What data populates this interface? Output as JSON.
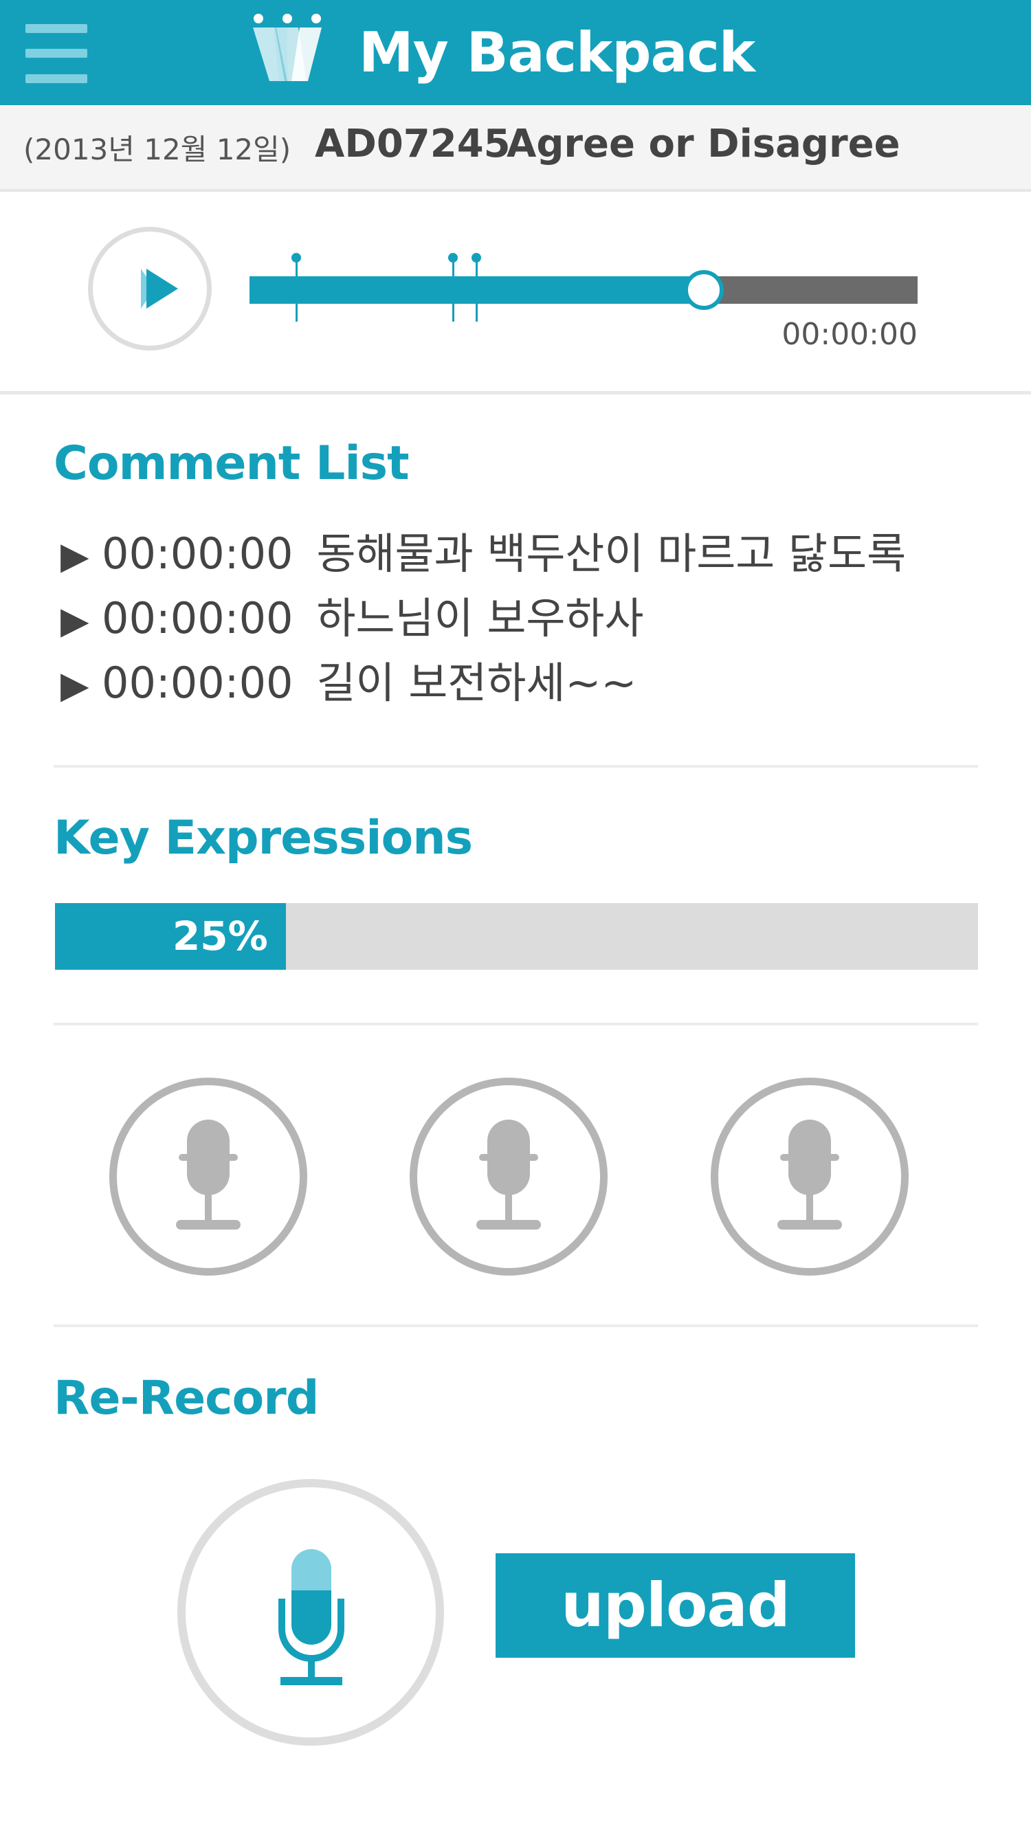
{
  "header": {
    "title": "My Backpack",
    "menu_icon": "hamburger-menu-icon",
    "logo": "w-logo",
    "color": "#14a0bb"
  },
  "subheader": {
    "date": "(2013년 12월 12일)",
    "code": "AD07245",
    "title": "Agree or Disagree"
  },
  "player": {
    "play_icon": "play-icon",
    "progress": 0.68,
    "markers": [
      0.07,
      0.305,
      0.34
    ],
    "time": "00:00:00"
  },
  "comment_list": {
    "title": "Comment List",
    "items": [
      {
        "time": "00:00:00",
        "text": "동해물과 백두산이 마르고 닳도록"
      },
      {
        "time": "00:00:00",
        "text": "하느님이 보우하사"
      },
      {
        "time": "00:00:00",
        "text": "길이 보전하세~~"
      }
    ]
  },
  "key_expressions": {
    "title": "Key Expressions",
    "progress_label": "25%",
    "progress": 0.25
  },
  "mic_buttons": [
    "microphone-icon",
    "microphone-icon",
    "microphone-icon"
  ],
  "rerecord": {
    "title": "Re-Record",
    "icon": "microphone-icon",
    "upload_label": "upload"
  }
}
